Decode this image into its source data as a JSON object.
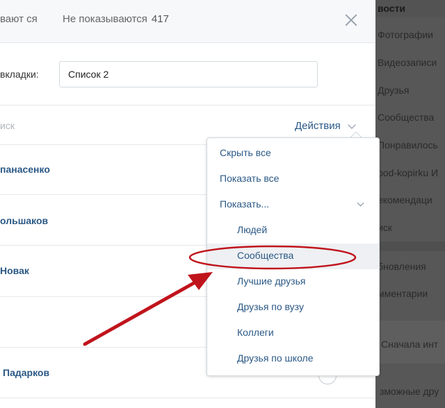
{
  "tabs": {
    "shown_label": "вают ся",
    "hidden_label": "Не показываются",
    "hidden_count": "417"
  },
  "name_row": {
    "label": "вкладки:",
    "input_value": "Список 2"
  },
  "search": {
    "placeholder": "иск",
    "actions_label": "Действия"
  },
  "friends": [
    {
      "name": "панасенко"
    },
    {
      "name": "ольшаков"
    },
    {
      "name": "Новак"
    },
    {
      "name": "Падарков"
    }
  ],
  "menu": {
    "items": [
      {
        "label": "Скрыть все"
      },
      {
        "label": "Показать все"
      },
      {
        "label": "Показать..."
      },
      {
        "label": "Людей"
      },
      {
        "label": "Сообщества"
      },
      {
        "label": "Лучшие друзья"
      },
      {
        "label": "Друзья по вузу"
      },
      {
        "label": "Коллеги"
      },
      {
        "label": "Друзья по школе"
      }
    ]
  },
  "sidebar": {
    "head": "вости",
    "items": [
      {
        "label": "Фотографии"
      },
      {
        "label": "Видеозаписи"
      },
      {
        "label": "Друзья"
      },
      {
        "label": "Сообщества"
      },
      {
        "label": "Понравилось"
      },
      {
        "label": "ood-kopirku И"
      },
      {
        "label": "екомендаци"
      },
      {
        "label": "иск"
      },
      {
        "label": "бновления"
      },
      {
        "label": "мментарии"
      },
      {
        "label": "Сначала инт"
      },
      {
        "label": "зможные дру"
      }
    ]
  },
  "colors": {
    "link": "#2a5885",
    "annotation": "#c0141c",
    "highlight": "#eef0f3"
  }
}
